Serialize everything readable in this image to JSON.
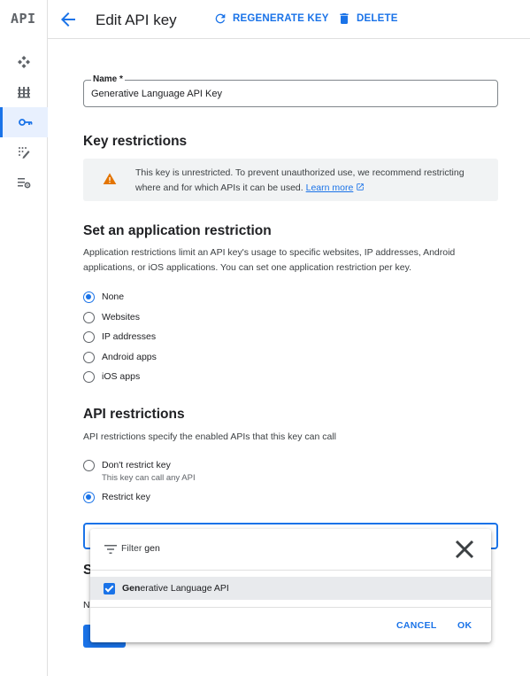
{
  "rail": {
    "logo": "API",
    "items": [
      {
        "icon": "dashboard-icon",
        "active": false
      },
      {
        "icon": "library-icon",
        "active": false
      },
      {
        "icon": "key-icon",
        "active": true
      },
      {
        "icon": "consent-icon",
        "active": false
      },
      {
        "icon": "page-settings-icon",
        "active": false
      }
    ]
  },
  "header": {
    "back_icon": "arrow-back-icon",
    "title": "Edit API key",
    "regenerate_label": "REGENERATE KEY",
    "delete_label": "DELETE"
  },
  "name_field": {
    "label": "Name *",
    "value": "Generative Language API Key"
  },
  "key_restrictions": {
    "heading": "Key restrictions",
    "warning_text": "This key is unrestricted. To prevent unauthorized use, we recommend restricting where and for which APIs it can be used.",
    "learn_more": "Learn more"
  },
  "application_restriction": {
    "heading": "Set an application restriction",
    "description": "Application restrictions limit an API key's usage to specific websites, IP addresses, Android applications, or iOS applications. You can set one application restriction per key.",
    "options": [
      {
        "label": "None",
        "selected": true
      },
      {
        "label": "Websites",
        "selected": false
      },
      {
        "label": "IP addresses",
        "selected": false
      },
      {
        "label": "Android apps",
        "selected": false
      },
      {
        "label": "iOS apps",
        "selected": false
      }
    ]
  },
  "api_restrictions": {
    "heading": "API restrictions",
    "description": "API restrictions specify the enabled APIs that this key can call",
    "dont_restrict_label": "Don't restrict key",
    "dont_restrict_sub": "This key can call any API",
    "restrict_label": "Restrict key",
    "selected": "Restrict key"
  },
  "hidden_behind_popup": {
    "heading_fragment": "S",
    "text_fragment": "N"
  },
  "popup": {
    "filter_label": "Filter",
    "filter_query": "gen",
    "option_match": "Gen",
    "option_rest": "erative Language API",
    "option_checked": true,
    "cancel_label": "CANCEL",
    "ok_label": "OK"
  },
  "colors": {
    "accent": "#1a73e8",
    "warning": "#e37400",
    "selected_bg": "#e8f0fe"
  }
}
